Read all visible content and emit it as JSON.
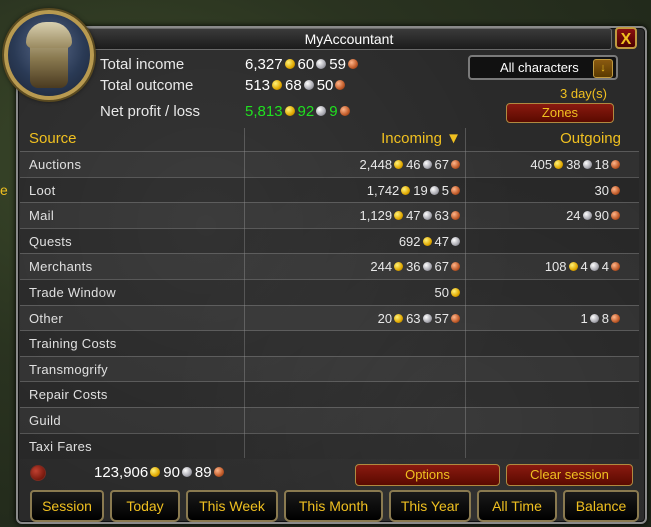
{
  "app": {
    "title": "MyAccountant",
    "close_label": "X"
  },
  "background": {
    "edge_text": "e"
  },
  "summary": {
    "total_income_label": "Total income",
    "total_income": {
      "gold": "6,327",
      "silver": "60",
      "copper": "59"
    },
    "total_outcome_label": "Total outcome",
    "total_outcome": {
      "gold": "513",
      "silver": "68",
      "copper": "50"
    },
    "net_label": "Net profit / loss",
    "net": {
      "gold": "5,813",
      "silver": "92",
      "copper": "9"
    }
  },
  "character_select": {
    "value": "All characters",
    "arrow": "↓"
  },
  "days": "3 day(s)",
  "zones_button": "Zones",
  "table": {
    "headers": {
      "source": "Source",
      "incoming": "Incoming ▼",
      "outgoing": "Outgoing"
    },
    "rows": [
      {
        "source": "Auctions",
        "in": [
          [
            "2,448",
            "gold"
          ],
          [
            "46",
            "silver"
          ],
          [
            "67",
            "copper"
          ]
        ],
        "out": [
          [
            "405",
            "gold"
          ],
          [
            "38",
            "silver"
          ],
          [
            "18",
            "copper"
          ]
        ]
      },
      {
        "source": "Loot",
        "in": [
          [
            "1,742",
            "gold"
          ],
          [
            "19",
            "silver"
          ],
          [
            "5",
            "copper"
          ]
        ],
        "out": [
          [
            "30",
            "copper"
          ]
        ]
      },
      {
        "source": "Mail",
        "in": [
          [
            "1,129",
            "gold"
          ],
          [
            "47",
            "silver"
          ],
          [
            "63",
            "copper"
          ]
        ],
        "out": [
          [
            "24",
            "silver"
          ],
          [
            "90",
            "copper"
          ]
        ]
      },
      {
        "source": "Quests",
        "in": [
          [
            "692",
            "gold"
          ],
          [
            "47",
            "silver"
          ]
        ],
        "out": []
      },
      {
        "source": "Merchants",
        "in": [
          [
            "244",
            "gold"
          ],
          [
            "36",
            "silver"
          ],
          [
            "67",
            "copper"
          ]
        ],
        "out": [
          [
            "108",
            "gold"
          ],
          [
            "4",
            "silver"
          ],
          [
            "4",
            "copper"
          ]
        ]
      },
      {
        "source": "Trade Window",
        "in": [
          [
            "50",
            "gold"
          ]
        ],
        "out": []
      },
      {
        "source": "Other",
        "in": [
          [
            "20",
            "gold"
          ],
          [
            "63",
            "silver"
          ],
          [
            "57",
            "copper"
          ]
        ],
        "out": [
          [
            "1",
            "silver"
          ],
          [
            "8",
            "copper"
          ]
        ]
      },
      {
        "source": "Training Costs",
        "in": [],
        "out": []
      },
      {
        "source": "Transmogrify",
        "in": [],
        "out": []
      },
      {
        "source": "Repair Costs",
        "in": [],
        "out": []
      },
      {
        "source": "Guild",
        "in": [],
        "out": []
      },
      {
        "source": "Taxi Fares",
        "in": [],
        "out": []
      }
    ]
  },
  "footer": {
    "total": {
      "gold": "123,906",
      "silver": "90",
      "copper": "89"
    },
    "options_button": "Options",
    "clear_session_button": "Clear session"
  },
  "tabs": [
    "Session",
    "Today",
    "This Week",
    "This Month",
    "This Year",
    "All Time",
    "Balance"
  ],
  "colors": {
    "accent_gold": "#f0c020",
    "net_green": "#20e020",
    "button_red": "#8a1a10"
  }
}
